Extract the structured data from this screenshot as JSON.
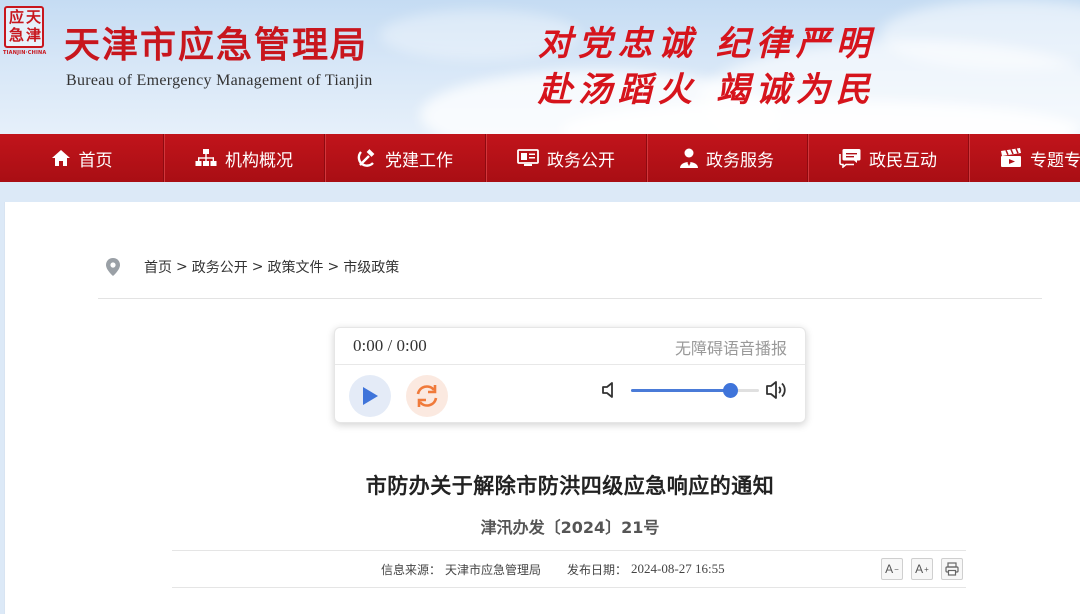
{
  "header": {
    "seal_chars": [
      "天",
      "津",
      "应",
      "急"
    ],
    "seal_tagline": "TIANJIN·CHINA",
    "title": "天津市应急管理局",
    "subtitle": "Bureau  of Emergency Management of Tianjin",
    "slogan_line1": "对党忠诚  纪律严明",
    "slogan_line2": "赴汤蹈火  竭诚为民",
    "brand_red": "#c8161d"
  },
  "nav": {
    "items": [
      {
        "label": "首页",
        "icon": "home-icon"
      },
      {
        "label": "机构概况",
        "icon": "org-chart-icon"
      },
      {
        "label": "党建工作",
        "icon": "hammer-sickle-icon"
      },
      {
        "label": "政务公开",
        "icon": "info-board-icon"
      },
      {
        "label": "政务服务",
        "icon": "user-service-icon"
      },
      {
        "label": "政民互动",
        "icon": "chat-icon"
      },
      {
        "label": "专题专栏",
        "icon": "clapperboard-icon"
      }
    ]
  },
  "breadcrumb": {
    "items": [
      "首页",
      "政务公开",
      "政策文件",
      "市级政策"
    ],
    "separator": ">"
  },
  "player": {
    "current_time": "0:00",
    "time_separator": "/",
    "duration": "0:00",
    "accessibility_label": "无障碍语音播报",
    "volume": 0.77
  },
  "article": {
    "title": "市防办关于解除市防洪四级应急响应的通知",
    "doc_number": "津汛办发〔2024〕21号",
    "source_label": "信息来源：",
    "source": "天津市应急管理局",
    "date_label": "发布日期：",
    "date": "2024-08-27 16:55"
  },
  "tools": {
    "font_smaller": "A",
    "font_smaller_sign": "−",
    "font_larger": "A",
    "font_larger_sign": "+"
  }
}
